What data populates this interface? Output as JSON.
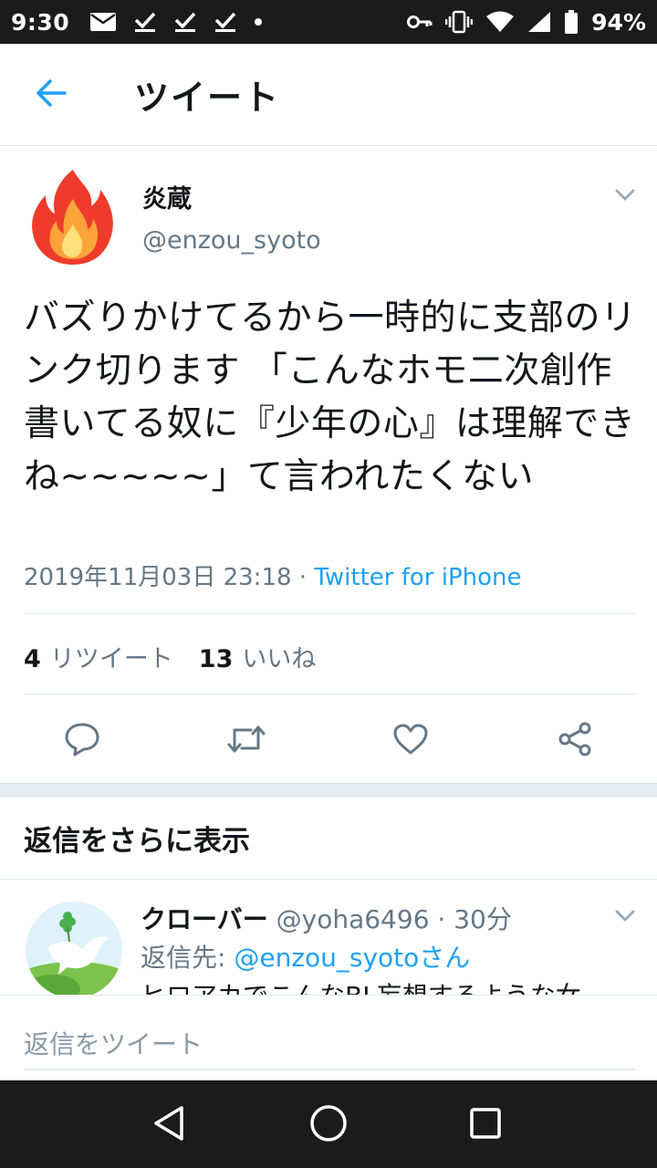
{
  "status_bar": {
    "time": "9:30",
    "battery": "94%",
    "icons_left": [
      "mail-icon",
      "check-icon",
      "check-icon",
      "check-icon",
      "dot-icon"
    ],
    "icons_right": [
      "key-icon",
      "vibrate-icon",
      "wifi-icon",
      "signal-icon",
      "battery-icon"
    ]
  },
  "header": {
    "title": "ツイート",
    "back_icon": "arrow-left-icon"
  },
  "tweet": {
    "display_name": "炎蔵",
    "handle": "@enzou_syoto",
    "text": "バズりかけてるから一時的に支部のリンク切ります 「こんなホモ二次創作書いてる奴に『少年の心』は理解できね~~~~~」て言われたくない",
    "timestamp": "2019年11月03日 23:18",
    "separator": " · ",
    "source": "Twitter for iPhone",
    "retweet_count": "4",
    "retweet_label": "リツイート",
    "like_count": "13",
    "like_label": "いいね",
    "actions": [
      "reply-icon",
      "retweet-icon",
      "like-icon",
      "share-icon"
    ]
  },
  "replies_section": {
    "show_more_label": "返信をさらに表示"
  },
  "reply": {
    "name": "クローバー",
    "handle": "@yoha6496",
    "separator": " · ",
    "time": "30分",
    "reply_to_prefix": "返信先: ",
    "reply_to_handle": "@enzou_syotoさん",
    "text_partial": "ヒロアカでこんなBL妄想するような女"
  },
  "compose": {
    "placeholder": "返信をツイート"
  },
  "colors": {
    "accent": "#1da1f2",
    "secondary_text": "#657786",
    "primary_text": "#14171a",
    "status_bar_bg": "#1b1b1b"
  }
}
